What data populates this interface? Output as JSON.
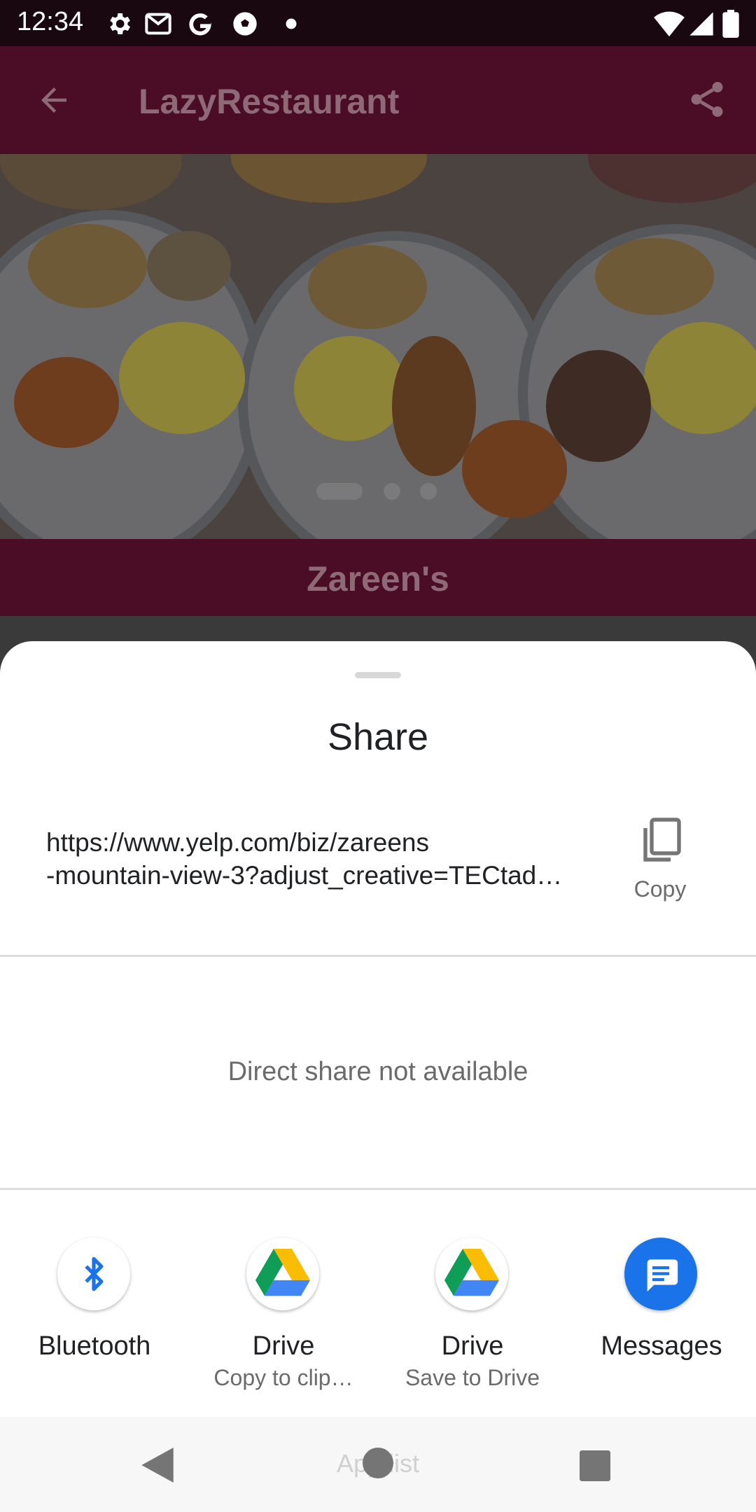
{
  "status_bar": {
    "time": "12:34",
    "left_icons": [
      "settings-icon",
      "gmail-icon",
      "google-icon",
      "soccer-ball-icon",
      "dot-icon"
    ],
    "right_icons": [
      "wifi-icon",
      "signal-icon",
      "battery-icon"
    ]
  },
  "app_bar": {
    "title": "LazyRestaurant",
    "back_icon": "arrow-left-icon",
    "share_icon": "share-icon"
  },
  "restaurant": {
    "name": "Zareen's",
    "carousel_pages": 3,
    "carousel_active": 1
  },
  "share_sheet": {
    "title": "Share",
    "url_line1": "https://www.yelp.com/biz/zareens",
    "url_line2": "-mountain-view-3?adjust_creative=TECtad…",
    "copy_label": "Copy",
    "direct_share_text": "Direct share not available",
    "apps": [
      {
        "label": "Bluetooth",
        "sublabel": "",
        "icon": "bluetooth-icon"
      },
      {
        "label": "Drive",
        "sublabel": "Copy to clip…",
        "icon": "google-drive-icon"
      },
      {
        "label": "Drive",
        "sublabel": "Save to Drive",
        "icon": "google-drive-icon"
      },
      {
        "label": "Messages",
        "sublabel": "",
        "icon": "messages-icon"
      }
    ]
  },
  "nav_bar": {
    "hint_text": "App list",
    "buttons": [
      "back-triangle-icon",
      "home-circle-icon",
      "recents-square-icon"
    ]
  },
  "colors": {
    "app_bar": "#4a0d25",
    "sheet": "#ffffff",
    "messages_blue": "#1a73e8",
    "bluetooth_blue": "#1a73e8"
  }
}
